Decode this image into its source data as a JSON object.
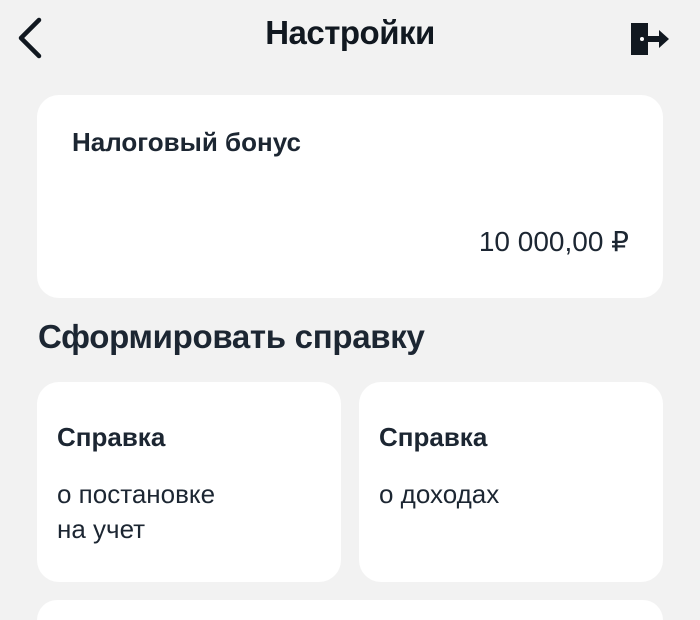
{
  "header": {
    "title": "Настройки",
    "back_icon": "chevron-left-icon",
    "logout_icon": "logout-icon"
  },
  "tax_bonus": {
    "title": "Налоговый бонус",
    "amount": "10 000,00 ₽"
  },
  "certificates": {
    "section_title": "Сформировать справку",
    "items": [
      {
        "title": "Справка",
        "subtitle": "о постановке\nна учет"
      },
      {
        "title": "Справка",
        "subtitle": "о доходах"
      }
    ]
  },
  "colors": {
    "background": "#f2f2f2",
    "card": "#ffffff",
    "text": "#1c2632"
  }
}
